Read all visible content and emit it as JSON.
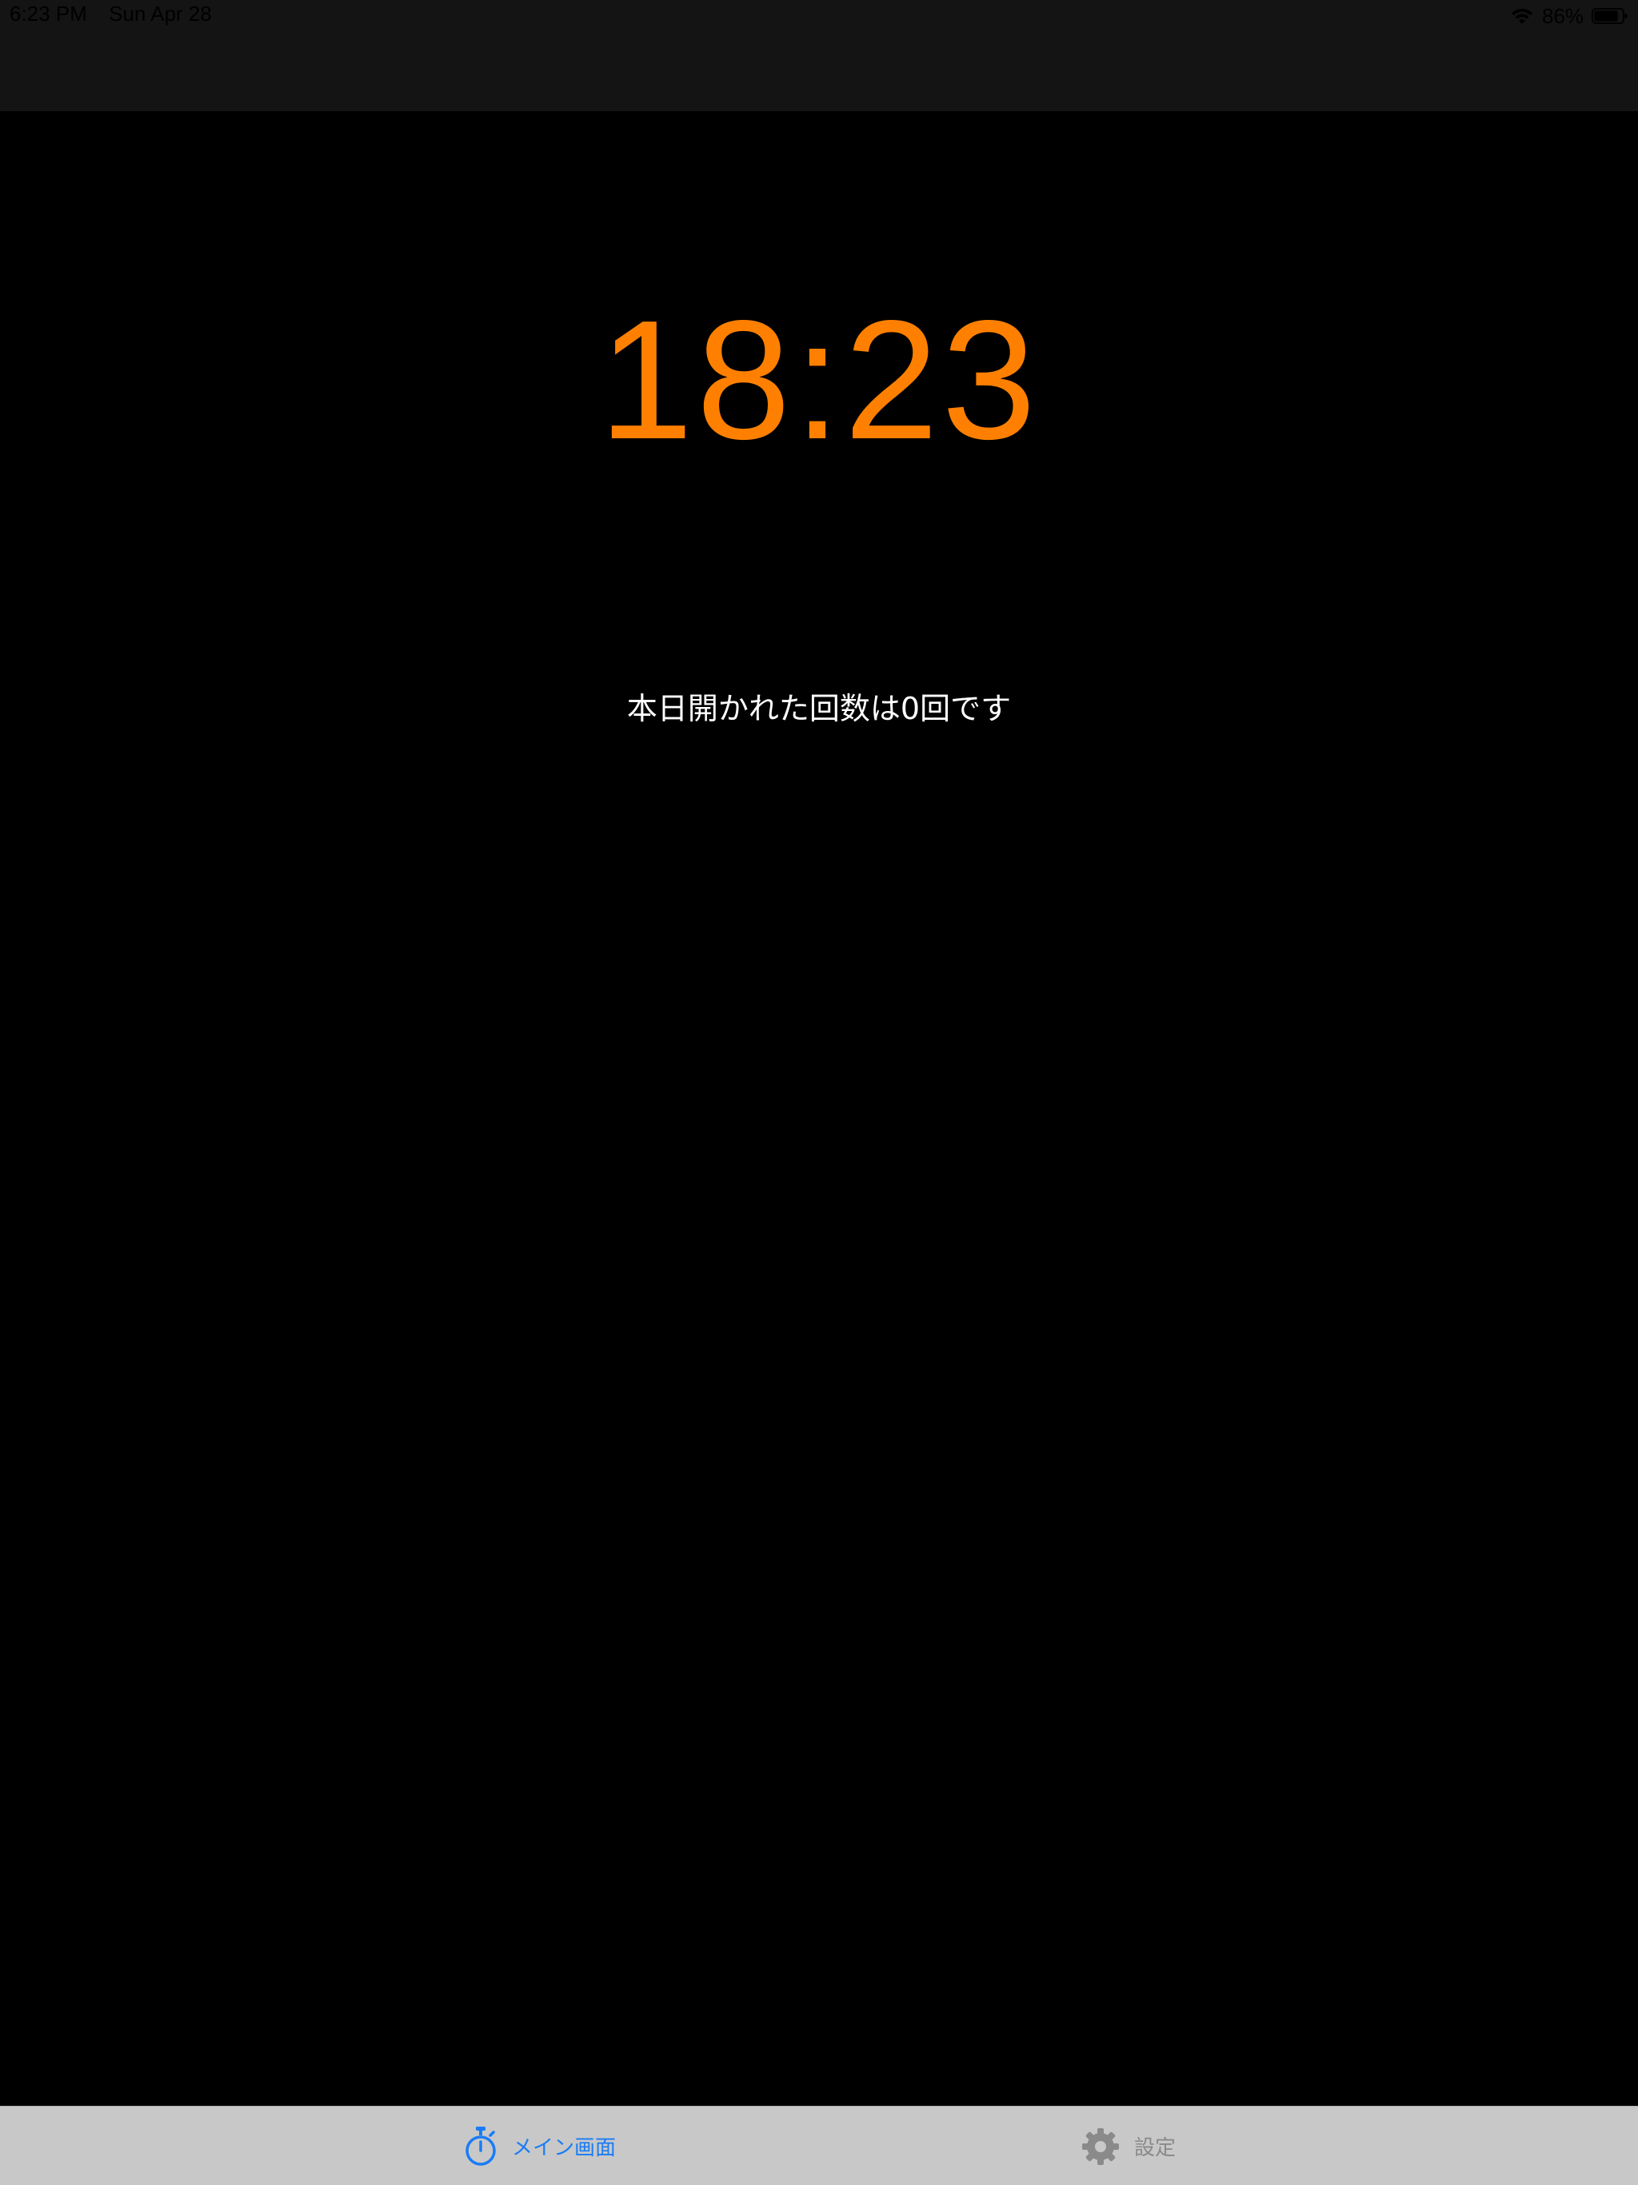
{
  "status_bar": {
    "time": "6:23 PM",
    "date": "Sun Apr 28",
    "battery_percent": "86%",
    "battery_level": 0.86,
    "wifi_icon": "wifi-icon",
    "battery_icon": "battery-icon"
  },
  "main": {
    "clock_time": "18:23",
    "open_count_message": "本日開かれた回数は0回です"
  },
  "tab_bar": {
    "tabs": [
      {
        "label": "メイン画面",
        "icon": "stopwatch-icon",
        "selected": true
      },
      {
        "label": "設定",
        "icon": "gear-icon",
        "selected": false
      }
    ]
  },
  "colors": {
    "clock": "#ff8000",
    "tab_selected": "#1a7cf5",
    "tab_unselected": "#8a8a8a",
    "background": "#000000",
    "tab_bar_background": "#c8c8c8"
  }
}
